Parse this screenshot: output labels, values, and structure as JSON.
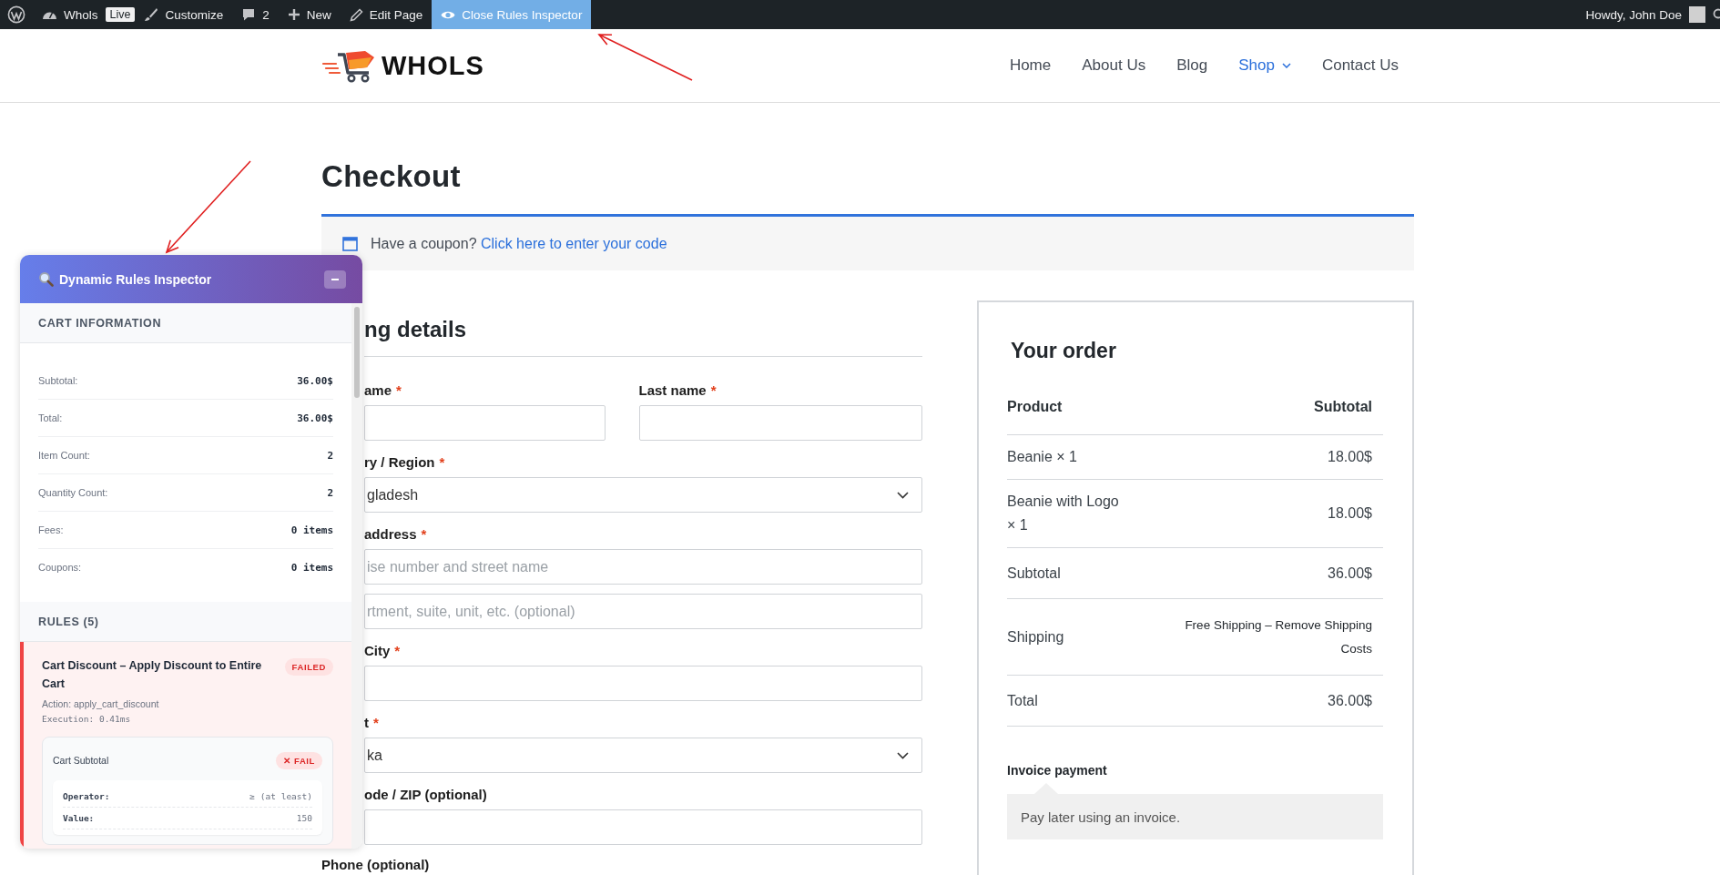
{
  "admin_bar": {
    "site": "Whols",
    "badge": "Live",
    "items": [
      {
        "label": "Customize",
        "kind": "customize",
        "selected": false
      },
      {
        "label": "2",
        "kind": "comments",
        "selected": false
      },
      {
        "label": "New",
        "kind": "new",
        "selected": false
      },
      {
        "label": "Edit Page",
        "kind": "edit",
        "selected": false
      },
      {
        "label": "Close Rules Inspector",
        "kind": "inspector",
        "selected": true
      }
    ],
    "greeting": "Howdy, John Doe"
  },
  "header": {
    "logo_text": "WHOLS",
    "nav": [
      {
        "label": "Home",
        "selected": false,
        "dropdown": false
      },
      {
        "label": "About Us",
        "selected": false,
        "dropdown": false
      },
      {
        "label": "Blog",
        "selected": false,
        "dropdown": false
      },
      {
        "label": "Shop",
        "selected": true,
        "dropdown": true
      },
      {
        "label": "Contact Us",
        "selected": false,
        "dropdown": false
      }
    ]
  },
  "page_title": "Checkout",
  "coupon": {
    "text": "Have a coupon?",
    "link": "Click here to enter your code"
  },
  "billing": {
    "heading": "ng details",
    "required_mark": "*",
    "rows": [
      {
        "fields": [
          {
            "kind": "text",
            "label": "ame",
            "required": true
          },
          {
            "kind": "text",
            "label": "Last name",
            "required": true
          }
        ]
      },
      {
        "fields": [
          {
            "kind": "select",
            "label": "ry / Region",
            "required": true,
            "value": "gladesh"
          }
        ]
      },
      {
        "fields": [
          {
            "kind": "text",
            "label": "address",
            "required": true,
            "placeholder": "ise number and street name"
          }
        ]
      },
      {
        "fields": [
          {
            "kind": "text",
            "placeholder": "rtment, suite, unit, etc. (optional)"
          }
        ]
      },
      {
        "fields": [
          {
            "kind": "text",
            "label": "City",
            "required": true
          }
        ]
      },
      {
        "fields": [
          {
            "kind": "select",
            "label": "t",
            "required": true,
            "value": "ka"
          }
        ]
      },
      {
        "fields": [
          {
            "kind": "text",
            "label": "ode / ZIP (optional)",
            "required": false
          }
        ]
      }
    ],
    "next_label": "Phone (optional)"
  },
  "order": {
    "title": "Your order",
    "columns": [
      "Product",
      "Subtotal"
    ],
    "items": [
      {
        "name": "Beanie × 1",
        "price": "18.00$"
      },
      {
        "name": "Beanie with Logo × 1",
        "price": "18.00$"
      }
    ],
    "totals": [
      {
        "label": "Subtotal",
        "value": "36.00$",
        "kind": "amount"
      },
      {
        "label": "Shipping",
        "value": "Free Shipping – Remove Shipping Costs",
        "kind": "shipping"
      },
      {
        "label": "Total",
        "value": "36.00$",
        "kind": "amount"
      }
    ],
    "payment": {
      "method": "Invoice payment",
      "description": "Pay later using an invoice."
    }
  },
  "inspector": {
    "title": "Dynamic Rules Inspector",
    "cart_info": {
      "heading": "CART INFORMATION",
      "rows": [
        {
          "label": "Subtotal:",
          "value": "36.00$"
        },
        {
          "label": "Total:",
          "value": "36.00$"
        },
        {
          "label": "Item Count:",
          "value": "2"
        },
        {
          "label": "Quantity Count:",
          "value": "2"
        },
        {
          "label": "Fees:",
          "value": "0 items"
        },
        {
          "label": "Coupons:",
          "value": "0 items"
        }
      ]
    },
    "rules": {
      "heading": "RULES (5)",
      "items": [
        {
          "title": "Cart Discount – Apply Discount to Entire Cart",
          "status": "FAILED",
          "passed": false,
          "action": "Action: apply_cart_discount",
          "execution": "Execution: 0.41ms",
          "conditions": [
            {
              "name": "Cart Subtotal",
              "status": "✕ FAIL",
              "passed": false,
              "details": [
                {
                  "label": "Operator:",
                  "value": "≥ (at least)"
                },
                {
                  "label": "Value:",
                  "value": "150"
                }
              ]
            }
          ]
        }
      ]
    }
  }
}
